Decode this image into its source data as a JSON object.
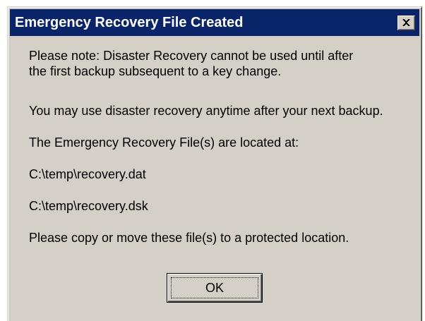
{
  "window": {
    "title": "Emergency Recovery File Created",
    "close_icon": "close-icon"
  },
  "message": {
    "note_line1": "Please note: Disaster Recovery cannot be used until after",
    "note_line2": "the first backup subsequent to a key change.",
    "anytime": "You may use disaster recovery anytime after your next backup.",
    "located": "The Emergency Recovery File(s) are located at:",
    "file_dat": "C:\\temp\\recovery.dat",
    "file_dsk": "C:\\temp\\recovery.dsk",
    "copy_instruction": "Please copy or move these file(s) to a protected location."
  },
  "buttons": {
    "ok_label": "OK"
  },
  "colors": {
    "titlebar": "#0a246a",
    "face": "#d4d0c8"
  }
}
